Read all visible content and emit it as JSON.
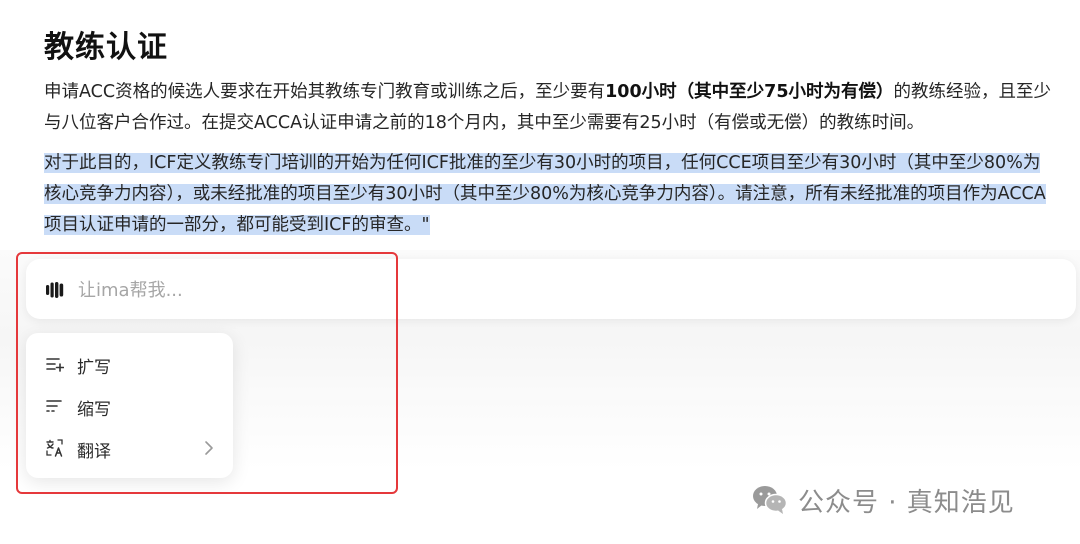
{
  "article": {
    "title": "教练认证",
    "para1": {
      "pre": "申请ACC资格的候选人要求在开始其教练专门教育或训练之后，至少要有",
      "bold": "100小时（其中至少75小时为有偿）",
      "post": "的教练经验，且至少与八位客户合作过。在提交ACCA认证申请之前的18个月内，其中至少需要有25小时（有偿或无偿）的教练时间。"
    },
    "para2": "对于此目的，ICF定义教练专门培训的开始为任何ICF批准的至少有30小时的项目，任何CCE项目至少有30小时（其中至少80%为核心竞争力内容），或未经批准的项目至少有30小时（其中至少80%为核心竞争力内容）。请注意，所有未经批准的项目作为ACCA项目认证申请的一部分，都可能受到ICF的审查。\""
  },
  "assistant": {
    "placeholder": "让ima帮我...",
    "icon": "ima-logo-icon"
  },
  "menu": {
    "items": [
      {
        "label": "扩写",
        "icon": "expand-text-icon"
      },
      {
        "label": "缩写",
        "icon": "shorten-text-icon"
      },
      {
        "label": "翻译",
        "icon": "translate-icon",
        "has_submenu": true
      }
    ]
  },
  "watermark": {
    "text": "公众号 · 真知浩见",
    "icon": "wechat-icon"
  },
  "colors": {
    "selection": "#c9dcf7",
    "highlight_border": "#e5383b",
    "placeholder": "#a6a6a6"
  }
}
